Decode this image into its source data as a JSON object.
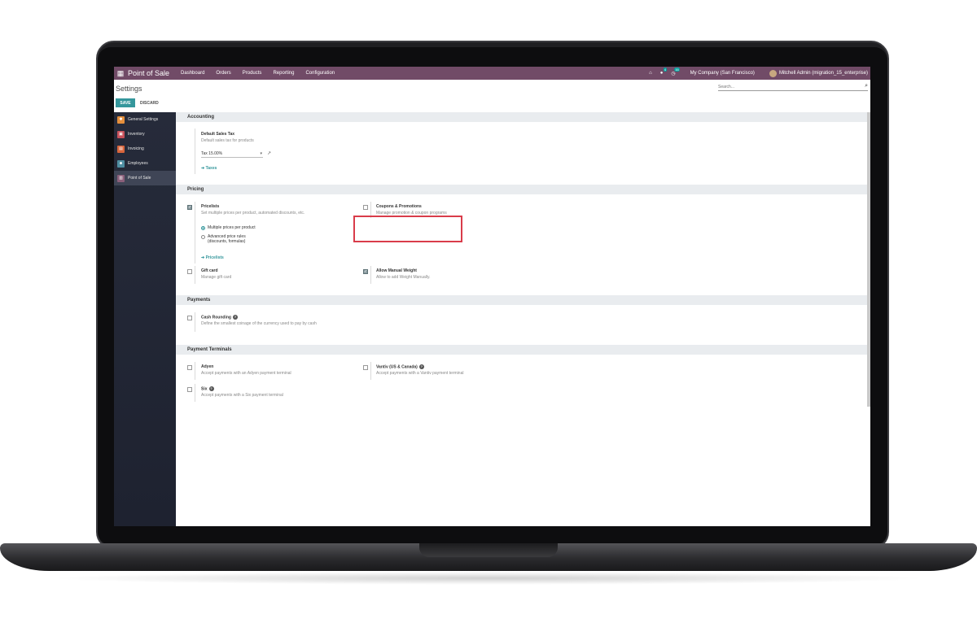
{
  "navbar": {
    "brand": "Point of Sale",
    "menus": [
      "Dashboard",
      "Orders",
      "Products",
      "Reporting",
      "Configuration"
    ],
    "chat_count": "4",
    "activity_count": "16",
    "company": "My Company (San Francisco)",
    "user": "Mitchell Admin (migration_15_enterprise)"
  },
  "control": {
    "title": "Settings",
    "search_placeholder": "Search...",
    "save_label": "SAVE",
    "discard_label": "DISCARD"
  },
  "sidebar": {
    "items": [
      {
        "label": "General Settings",
        "color": "#e58f3c"
      },
      {
        "label": "Inventory",
        "color": "#c8515b"
      },
      {
        "label": "Invoicing",
        "color": "#d8653c"
      },
      {
        "label": "Employees",
        "color": "#4f8fa2"
      },
      {
        "label": "Point of Sale",
        "color": "#8a5f7a"
      }
    ]
  },
  "accounting": {
    "title": "Accounting",
    "default_tax_label": "Default Sales Tax",
    "default_tax_help": "Default sales tax for products",
    "tax_value": "Tax 15.00%",
    "taxes_link": "Taxes"
  },
  "pricing": {
    "title": "Pricing",
    "pricelists_label": "Pricelists",
    "pricelists_help": "Set multiple prices per product, automated discounts, etc.",
    "radio_multiple": "Multiple prices per product",
    "radio_advanced_1": "Advanced price rules",
    "radio_advanced_2": "(discounts, formulas)",
    "pricelists_link": "Pricelists",
    "coupons_label": "Coupons & Promotions",
    "coupons_help": "Manage promotion & coupon programs",
    "giftcard_label": "Gift card",
    "giftcard_help": "Manage gift card",
    "weight_label": "Allow Manual Weight",
    "weight_help": "Allow to add Weight Manually."
  },
  "payments": {
    "title": "Payments",
    "rounding_label": "Cash Rounding",
    "rounding_help": "Define the smallest coinage of the currency used to pay by cash"
  },
  "terminals": {
    "title": "Payment Terminals",
    "adyen_label": "Adyen",
    "adyen_help": "Accept payments with an Adyen payment terminal",
    "vantiv_label": "Vantiv (US & Canada)",
    "vantiv_help": "Accept payments with a Vantiv payment terminal",
    "six_label": "Six",
    "six_help": "Accept payments with a Six payment terminal"
  }
}
